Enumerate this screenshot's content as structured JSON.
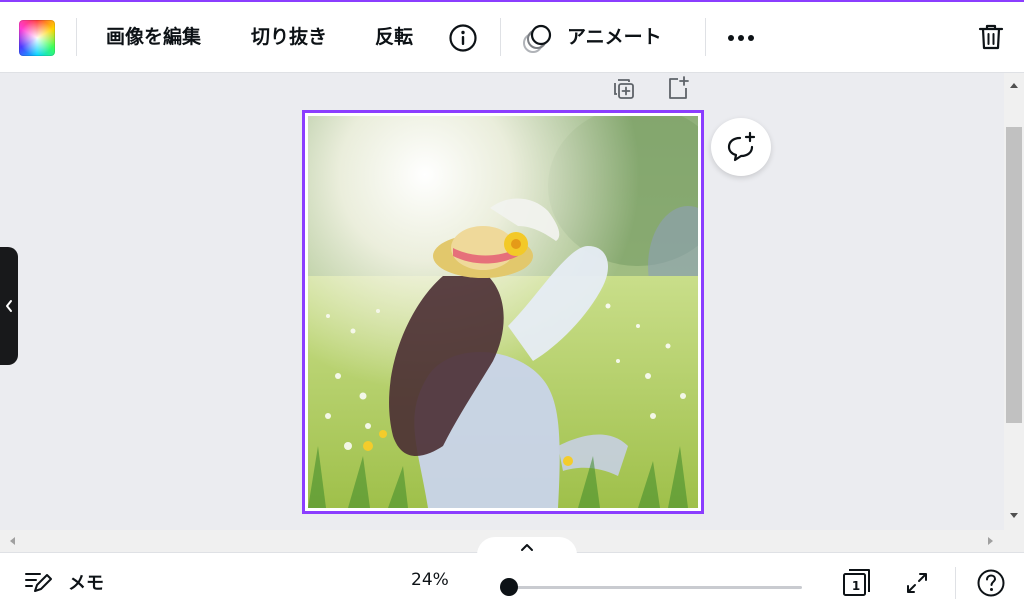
{
  "toolbar": {
    "edit_image": "画像を編集",
    "crop": "切り抜き",
    "flip": "反転",
    "animate": "アニメート",
    "icons": [
      "color-picker-icon",
      "info-icon",
      "animate-icon",
      "more-icon",
      "trash-icon"
    ]
  },
  "canvas": {
    "overlay_icons": [
      "duplicate-page-icon",
      "add-page-icon",
      "add-comment-icon"
    ],
    "selection_color": "#8b3dff"
  },
  "footer": {
    "notes_label": "メモ",
    "zoom_label": "24%",
    "zoom_fraction": 0.0,
    "page_number": "1"
  },
  "colors": {
    "accent": "#8b3dff",
    "text": "#0d1216",
    "canvas_bg": "#ebecf0"
  }
}
